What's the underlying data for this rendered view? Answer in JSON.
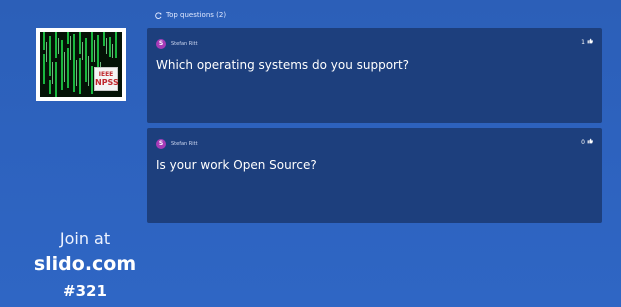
{
  "sidebar": {
    "logo_badge": {
      "line1": "IEEE",
      "line2": "NPSS"
    },
    "join_label": "Join at",
    "join_site": "slido.com",
    "join_code": "#321"
  },
  "section": {
    "icon": "refresh-icon",
    "title": "Top questions (2)"
  },
  "questions": [
    {
      "author_initial": "S",
      "author": "Stefan Ritt",
      "likes": "1",
      "text": "Which operating systems do you support?"
    },
    {
      "author_initial": "S",
      "author": "Stefan Ritt",
      "likes": "0",
      "text": "Is your work Open Source?"
    }
  ],
  "colors": {
    "background": "#2d62be",
    "card": "#1d3f7d",
    "avatar": "#a73bb7"
  }
}
